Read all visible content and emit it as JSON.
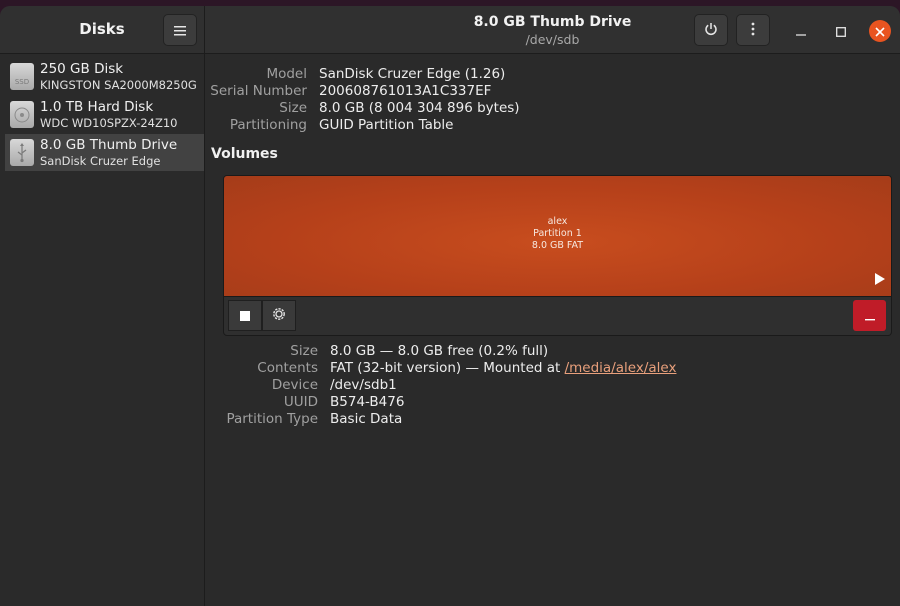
{
  "app": {
    "title": "Disks",
    "menu_icon": "hamburger-menu-icon"
  },
  "window": {
    "title": "8.0 GB Thumb Drive",
    "subtitle": "/dev/sdb",
    "power_icon": "power-icon",
    "more_icon": "vertical-dots-icon",
    "accent_close": "#e95420"
  },
  "sidebar": {
    "items": [
      {
        "name": "250 GB Disk",
        "desc": "KINGSTON SA2000M8250G",
        "icon": "ssd-icon",
        "icon_text": "SSD",
        "selected": false
      },
      {
        "name": "1.0 TB Hard Disk",
        "desc": "WDC WD10SPZX-24Z10",
        "icon": "hard-disk-icon",
        "selected": false
      },
      {
        "name": "8.0 GB Thumb Drive",
        "desc": "SanDisk Cruzer Edge",
        "icon": "usb-icon",
        "selected": true
      }
    ]
  },
  "drive": {
    "labels": {
      "model": "Model",
      "serial": "Serial Number",
      "size": "Size",
      "partitioning": "Partitioning"
    },
    "model": "SanDisk Cruzer Edge (1.26)",
    "serial": "200608761013A1C337EF",
    "size": "8.0 GB (8 004 304 896 bytes)",
    "partitioning": "GUID Partition Table"
  },
  "volumes": {
    "title": "Volumes",
    "partition": {
      "label": "alex",
      "name": "Partition 1",
      "size_fs": "8.0 GB FAT",
      "color": "#b8431b"
    },
    "toolbar": {
      "stop_icon": "stop-icon",
      "settings_icon": "gear-icon",
      "delete_icon": "minus-icon",
      "delete_color": "#c01c28"
    }
  },
  "partition_details": {
    "labels": {
      "size": "Size",
      "contents": "Contents",
      "device": "Device",
      "uuid": "UUID",
      "type": "Partition Type"
    },
    "size": "8.0 GB — 8.0 GB free (0.2% full)",
    "contents_prefix": "FAT (32-bit version) — Mounted at ",
    "mount_path": "/media/alex/alex",
    "device": "/dev/sdb1",
    "uuid": "B574-B476",
    "type": "Basic Data"
  }
}
